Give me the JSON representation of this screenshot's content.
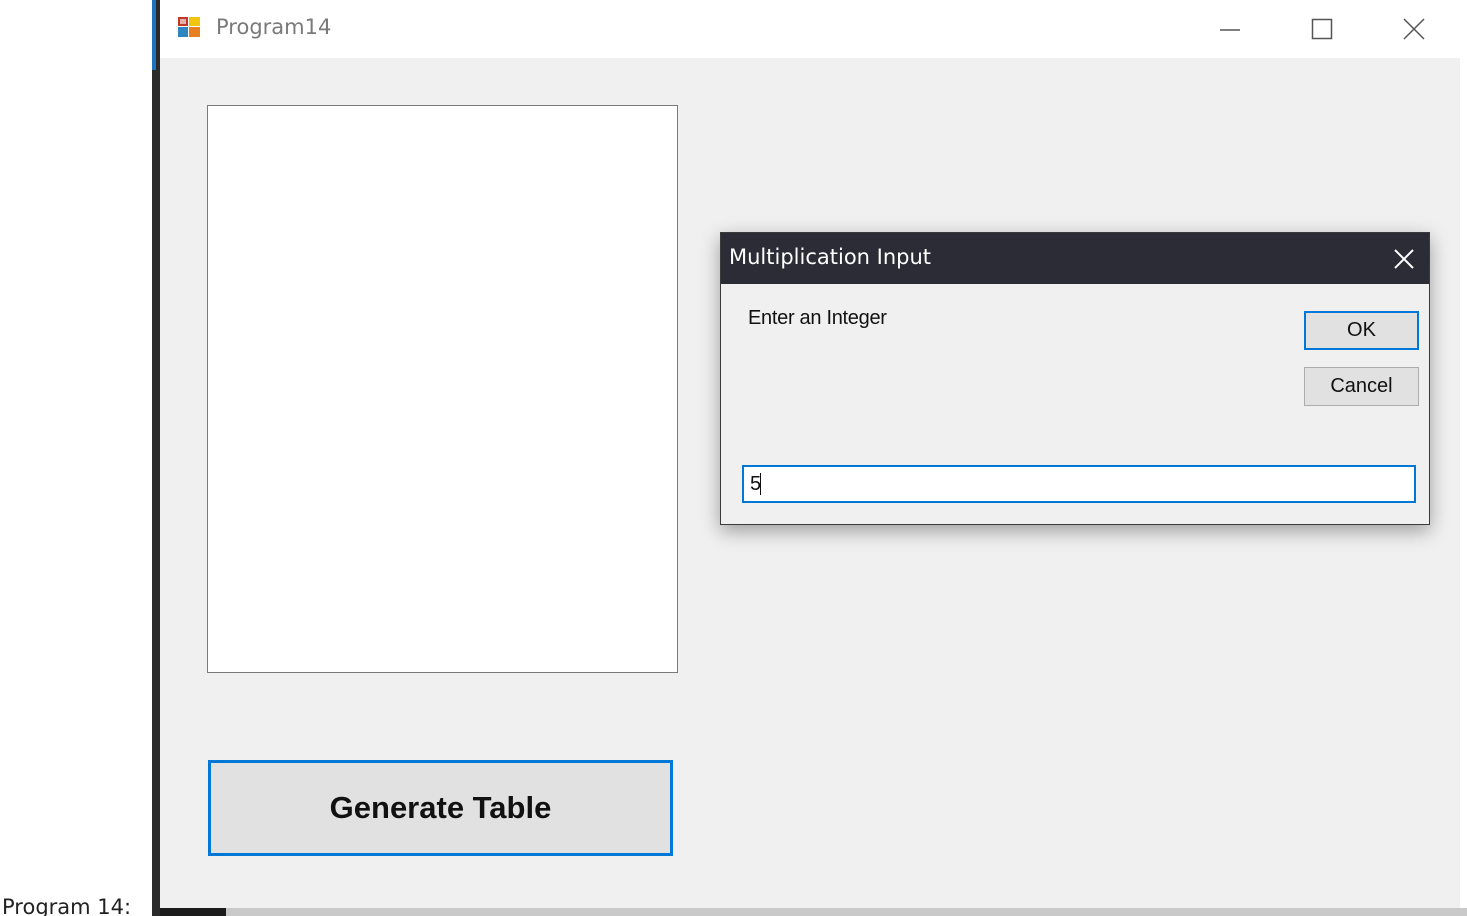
{
  "caption": "Program 14:",
  "window": {
    "title": "Program14",
    "controls": {
      "minimize_icon": "minimize-icon",
      "maximize_icon": "maximize-icon",
      "close_icon": "close-icon"
    }
  },
  "main": {
    "generate_button_label": "Generate Table"
  },
  "dialog": {
    "title": "Multiplication Input",
    "prompt": "Enter an Integer",
    "ok_label": "OK",
    "cancel_label": "Cancel",
    "input_value": "5"
  },
  "colors": {
    "accent": "#0078d7",
    "dialog_titlebar": "#2b2c35",
    "window_background": "#f0f0f0"
  }
}
